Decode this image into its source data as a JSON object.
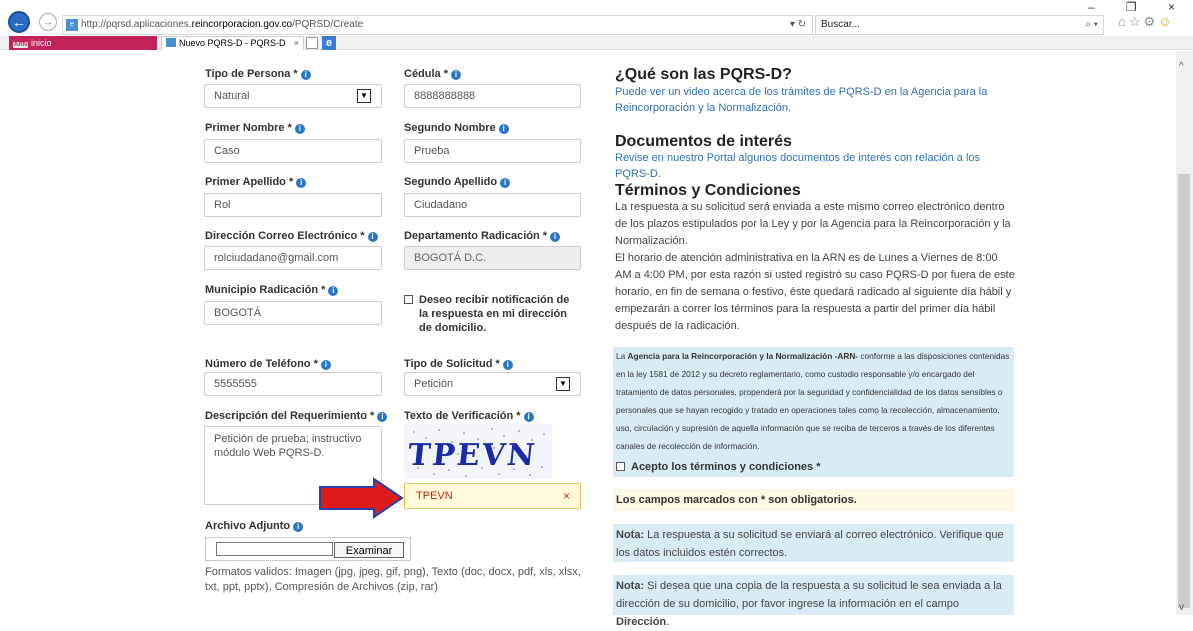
{
  "browser": {
    "url_prefix": "http://pqrsd.aplicaciones.",
    "url_host": "reincorporacion.gov.co",
    "url_path": "/PQRSD/Create",
    "url_actions": "▾ ↻",
    "search_placeholder": "Buscar...",
    "search_go": "⌕ ▾",
    "favorite_badge": "ARN",
    "favorite_label": "inicio",
    "tab_title": "Nuevo PQRS-D - PQRS-D",
    "tab_close": "×",
    "window_controls": "– ❐ ×"
  },
  "form": {
    "tipo_persona": {
      "label": "Tipo de Persona *",
      "value": "Natural"
    },
    "cedula": {
      "label": "Cédula *",
      "value": "8888888888"
    },
    "primer_nombre": {
      "label": "Primer Nombre *",
      "value": "Caso"
    },
    "segundo_nombre": {
      "label": "Segundo Nombre",
      "value": "Prueba"
    },
    "primer_apellido": {
      "label": "Primer Apellido *",
      "value": "Rol"
    },
    "segundo_apellido": {
      "label": "Segundo Apellido",
      "value": "Ciudadano"
    },
    "correo": {
      "label": "Dirección Correo Electrónico *",
      "value": "rolciudadano@gmail.com"
    },
    "departamento": {
      "label": "Departamento Radicación *",
      "value": "BOGOTÁ D.C."
    },
    "municipio": {
      "label": "Municipio Radicación *",
      "value": "BOGOTÁ"
    },
    "notificacion": {
      "label": "Deseo recibir notificación de la respuesta en mi dirección de domicilio."
    },
    "telefono": {
      "label": "Número de Teléfono *",
      "value": "5555555"
    },
    "tipo_solicitud": {
      "label": "Tipo de Solicitud *",
      "value": "Petición"
    },
    "descripcion": {
      "label": "Descripción del Requerimiento *",
      "value": "Petición de prueba; instructivo módulo Web PQRS-D."
    },
    "verificacion": {
      "label": "Texto de Verificación *",
      "captcha": "TPEVN",
      "value": "TPEVN",
      "clear": "×"
    },
    "adjunto": {
      "label": "Archivo Adjunto",
      "button": "Examinar",
      "formats": "Formatos validos: Imagen (jpg, jpeg, gif, png), Texto (doc, docx, pdf, xls, xlsx, txt, ppt, pptx), Compresión de Archivos (zip, rar)"
    }
  },
  "info": {
    "que_son_title": "¿Qué son las PQRS-D?",
    "que_son_link": "Puede ver un video acerca de los trámites de PQRS-D en la Agencia para la Reincorporación y la Normalización.",
    "documentos_title": "Documentos de interés",
    "documentos_link": "Revise en nuestro Portal algunos documentos de interés con relación a los PQRS-D.",
    "terminos_title": "Términos y Condiciones",
    "terminos_p1": "La respuesta a su solicitud será enviada a este mismo correo electrónico dentro de los plazos estipulados por la Ley y por la Agencia para la Reincorporación y la Normalización.",
    "terminos_p2": "El horario de atención administrativa en la ARN es de Lunes a Viernes de 8:00 AM a 4:00 PM, por esta razón si usted registró su caso PQRS-D por fuera de este horario, en fin de semana o festivo, éste quedará radicado al siguiente día hábil y empezarán a correr los términos para la respuesta a partir del primer día hábil después de la radicación.",
    "arn_prefix": "La ",
    "arn_bold": "Agencia para la Reincorporación y la Normalización -ARN-",
    "arn_rest": " conforme a las disposiciones contenidas en la ley 1581 de 2012 y su decreto reglamentario, como custodio responsable y/o encargado del tratamiento de datos personales, propenderá por la seguridad y confidencialidad de los datos sensibles o personales que se hayan recogido y tratado en operaciones tales como la recolección, almacenamiento, uso, circulación y supresión de aquella información que se reciba de terceros a través de los diferentes canales de recolección de información.",
    "acepto": "Acepto los términos y condiciones *",
    "obligatorios": "Los campos marcados con * son obligatorios.",
    "nota_label": "Nota:",
    "nota1": " La respuesta a su solicitud se enviará al correo electrónico. Verifique que los datos incluidos estén correctos.",
    "nota2_pre": " Si desea que una copia de la respuesta a su solicitud le sea enviada a la dirección de su domicilio, por favor ingrese la información en el campo ",
    "nota2_bold": "Dirección",
    "nota2_end": "."
  },
  "colors": {
    "accent": "#2f6fb8",
    "info_box": "#d9ecf6",
    "warning_box": "#fcf8e3",
    "arrow": "#e01b1b",
    "verification_text": "#c8220f"
  },
  "icons": [
    "back-arrow-icon",
    "forward-arrow-icon",
    "refresh-icon",
    "search-icon",
    "home-icon",
    "star-icon",
    "gear-icon",
    "smiley-icon",
    "info-icon",
    "dropdown-arrow-icon",
    "checkbox-icon",
    "clear-icon",
    "red-arrow-icon"
  ]
}
